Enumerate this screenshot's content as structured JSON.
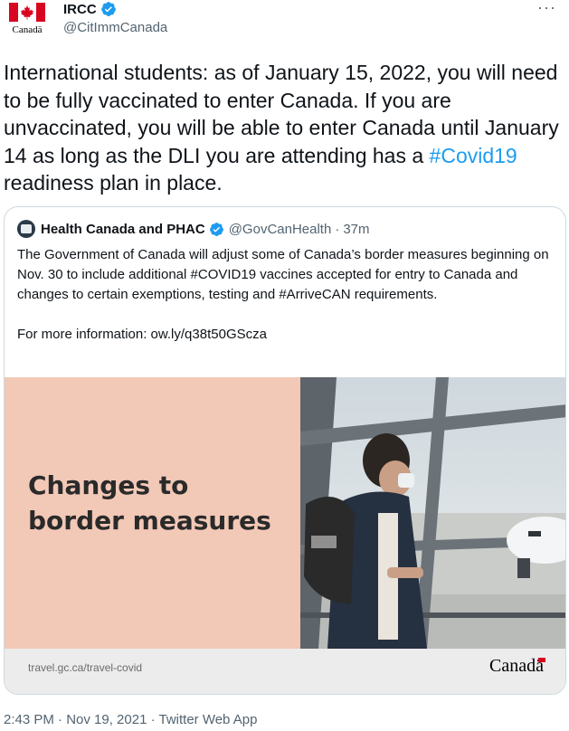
{
  "account": {
    "display_name": "IRCC",
    "handle": "@CitImmCanada",
    "avatar_wordmark": "Canadä",
    "more_label": "···"
  },
  "tweet": {
    "text_main": "International students: as of January 15, 2022, you will need to be fully vaccinated to enter Canada. If you are unvaccinated, you will be able to enter Canada until January 14 as long as the DLI you are attending has a ",
    "hashtag": "#Covid19",
    "text_tail": " readiness plan in place."
  },
  "quoted": {
    "display_name": "Health Canada and PHAC",
    "handle": "@GovCanHealth",
    "separator": "·",
    "time": "37m",
    "paragraph_1": "The Government of Canada will adjust some of Canada’s border measures beginning on Nov. 30 to include additional #COVID19 vaccines accepted for entry to Canada and changes to certain exemptions, testing and #ArriveCAN requirements.",
    "paragraph_2": "For more information: ow.ly/q38t50GScza",
    "media": {
      "headline": "Changes to border measures",
      "url_text": "travel.gc.ca/travel-covid",
      "brand": "Canadä"
    }
  },
  "meta": {
    "text": "2:43 PM · Nov 19, 2021 · Twitter Web App"
  },
  "colors": {
    "link": "#1d9bf0",
    "secondary_text": "#536471",
    "media_panel": "#f2c8b7",
    "flag_red": "#d80621"
  }
}
